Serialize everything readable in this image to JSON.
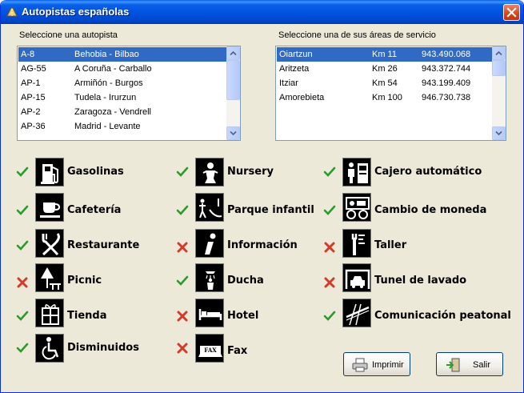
{
  "window": {
    "title": "Autopistas españolas"
  },
  "left_panel": {
    "label": "Seleccione una autopista",
    "rows": [
      {
        "code": "A-8",
        "route": "Behobia - Bilbao"
      },
      {
        "code": "AG-55",
        "route": "A Coruña - Carballo"
      },
      {
        "code": "AP-1",
        "route": "Armiñón - Burgos"
      },
      {
        "code": "AP-15",
        "route": "Tudela - Irurzun"
      },
      {
        "code": "AP-2",
        "route": "Zaragoza - Vendrell"
      },
      {
        "code": "AP-36",
        "route": "Madrid - Levante"
      }
    ],
    "selected_index": 0
  },
  "right_panel": {
    "label": "Seleccione una de sus áreas de servicio",
    "rows": [
      {
        "name": "Oiartzun",
        "km": "Km 11",
        "phone": "943.490.068"
      },
      {
        "name": "Aritzeta",
        "km": "Km 26",
        "phone": "943.372.744"
      },
      {
        "name": "Itziar",
        "km": "Km 54",
        "phone": "943.199.409"
      },
      {
        "name": "Amorebieta",
        "km": "Km 100",
        "phone": "946.730.738"
      }
    ],
    "selected_index": 0
  },
  "services": {
    "gasolinas": {
      "label": "Gasolinas",
      "available": true,
      "icon": "fuel-pump-icon"
    },
    "cafeteria": {
      "label": "Cafetería",
      "available": true,
      "icon": "coffee-cup-icon"
    },
    "restaurante": {
      "label": "Restaurante",
      "available": true,
      "icon": "fork-knife-icon"
    },
    "picnic": {
      "label": "Picnic",
      "available": false,
      "icon": "picnic-icon"
    },
    "tienda": {
      "label": "Tienda",
      "available": true,
      "icon": "gift-icon"
    },
    "disminuidos": {
      "label": "Disminuidos",
      "available": true,
      "icon": "wheelchair-icon"
    },
    "nursery": {
      "label": "Nursery",
      "available": true,
      "icon": "baby-icon"
    },
    "parque": {
      "label": "Parque infantil",
      "available": true,
      "icon": "playground-icon"
    },
    "informacion": {
      "label": "Información",
      "available": false,
      "icon": "info-icon"
    },
    "ducha": {
      "label": "Ducha",
      "available": true,
      "icon": "shower-icon"
    },
    "hotel": {
      "label": "Hotel",
      "available": false,
      "icon": "bed-icon"
    },
    "fax": {
      "label": "Fax",
      "available": false,
      "icon": "fax-icon"
    },
    "cajero": {
      "label": "Cajero automático",
      "available": true,
      "icon": "atm-icon"
    },
    "cambio": {
      "label": "Cambio de moneda",
      "available": true,
      "icon": "currency-exchange-icon"
    },
    "taller": {
      "label": "Taller",
      "available": false,
      "icon": "wrench-icon"
    },
    "tunel": {
      "label": "Tunel de lavado",
      "available": false,
      "icon": "car-wash-icon"
    },
    "comunicacion": {
      "label": "Comunicación peatonal",
      "available": true,
      "icon": "footbridge-icon"
    }
  },
  "buttons": {
    "print": "Imprimir",
    "exit": "Salir"
  },
  "colors": {
    "check": "#2e9a2e",
    "cross": "#d33a2a",
    "selection": "#316ac5",
    "titlebar": "#0054e3"
  }
}
